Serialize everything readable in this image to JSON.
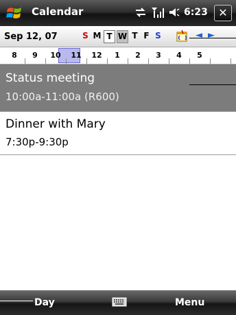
{
  "titlebar": {
    "app_title": "Calendar",
    "time": "6:23",
    "icons": [
      "windows-start-icon",
      "connectivity-icon",
      "signal-icon",
      "speaker-icon",
      "close-icon"
    ],
    "close_label": "✕"
  },
  "datebar": {
    "date": "Sep 12, 07",
    "weekdays": [
      {
        "label": "S",
        "color": "#d40000"
      },
      {
        "label": "M",
        "color": "#000000"
      },
      {
        "label": "T",
        "color": "#000000"
      },
      {
        "label": "W",
        "color": "#000000"
      },
      {
        "label": "T",
        "color": "#000000"
      },
      {
        "label": "F",
        "color": "#000000"
      },
      {
        "label": "S",
        "color": "#1a3fd1"
      }
    ],
    "prev_label": "◄",
    "next_label": "►"
  },
  "hours": [
    "8",
    "9",
    "10",
    "11",
    "12",
    "1",
    "2",
    "3",
    "4",
    "5"
  ],
  "appointments": [
    {
      "subject": "Status meeting",
      "time": "10:00a-11:00a (R600)",
      "selected": true
    },
    {
      "subject": "Dinner with Mary",
      "time": "7:30p-9:30p",
      "selected": false
    }
  ],
  "softkeys": {
    "left": "Day",
    "right": "Menu"
  },
  "colors": {
    "selected_row": "#7c7c7c",
    "selected_hour": "#b9b9ee"
  }
}
